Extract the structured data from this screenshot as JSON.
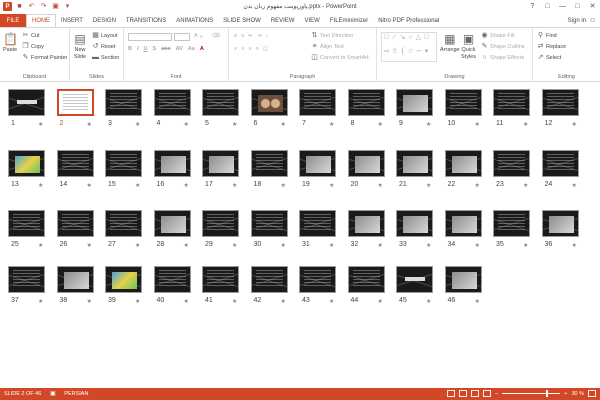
{
  "window": {
    "title": "پاورپوینت مفهوم زبان بدن.pptx - PowerPoint",
    "sign_in": "Sign in"
  },
  "tabs": [
    "FILE",
    "HOME",
    "INSERT",
    "DESIGN",
    "TRANSITIONS",
    "ANIMATIONS",
    "SLIDE SHOW",
    "REVIEW",
    "VIEW",
    "FILEminimizer",
    "Nitro PDF Professional"
  ],
  "ribbon": {
    "clipboard": {
      "label": "Clipboard",
      "paste": "Paste",
      "cut": "Cut",
      "copy": "Copy",
      "format_painter": "Format Painter"
    },
    "slides": {
      "label": "Slides",
      "new_slide": "New",
      "new_slide2": "Slide",
      "layout": "Layout",
      "reset": "Reset",
      "section": "Section"
    },
    "font": {
      "label": "Font"
    },
    "paragraph": {
      "label": "Paragraph",
      "text_direction": "Text Direction",
      "align_text": "Align Text",
      "convert": "Convert to SmartArt"
    },
    "drawing": {
      "label": "Drawing",
      "arrange": "Arrange",
      "quick_styles": "Quick",
      "quick_styles2": "Styles",
      "shape_fill": "Shape Fill",
      "shape_outline": "Shape Outline",
      "shape_effects": "Shape Effects"
    },
    "editing": {
      "label": "Editing",
      "find": "Find",
      "replace": "Replace",
      "select": "Select"
    }
  },
  "slides": [
    {
      "n": "1",
      "t": "logo"
    },
    {
      "n": "2",
      "t": "white"
    },
    {
      "n": "3",
      "t": "text"
    },
    {
      "n": "4",
      "t": "text"
    },
    {
      "n": "5",
      "t": "text"
    },
    {
      "n": "6",
      "t": "face"
    },
    {
      "n": "7",
      "t": "text"
    },
    {
      "n": "8",
      "t": "text"
    },
    {
      "n": "9",
      "t": "pic"
    },
    {
      "n": "10",
      "t": "text"
    },
    {
      "n": "11",
      "t": "text"
    },
    {
      "n": "12",
      "t": "text"
    },
    {
      "n": "13",
      "t": "color"
    },
    {
      "n": "14",
      "t": "text"
    },
    {
      "n": "15",
      "t": "text"
    },
    {
      "n": "16",
      "t": "pic"
    },
    {
      "n": "17",
      "t": "pic"
    },
    {
      "n": "18",
      "t": "text"
    },
    {
      "n": "19",
      "t": "pic"
    },
    {
      "n": "20",
      "t": "pic"
    },
    {
      "n": "21",
      "t": "pic"
    },
    {
      "n": "22",
      "t": "pic"
    },
    {
      "n": "23",
      "t": "text"
    },
    {
      "n": "24",
      "t": "text"
    },
    {
      "n": "25",
      "t": "text"
    },
    {
      "n": "26",
      "t": "text"
    },
    {
      "n": "27",
      "t": "text"
    },
    {
      "n": "28",
      "t": "pic"
    },
    {
      "n": "29",
      "t": "text"
    },
    {
      "n": "30",
      "t": "text"
    },
    {
      "n": "31",
      "t": "text"
    },
    {
      "n": "32",
      "t": "pic"
    },
    {
      "n": "33",
      "t": "pic"
    },
    {
      "n": "34",
      "t": "pic"
    },
    {
      "n": "35",
      "t": "text"
    },
    {
      "n": "36",
      "t": "pic"
    },
    {
      "n": "37",
      "t": "text"
    },
    {
      "n": "38",
      "t": "pic"
    },
    {
      "n": "39",
      "t": "color"
    },
    {
      "n": "40",
      "t": "text"
    },
    {
      "n": "41",
      "t": "text"
    },
    {
      "n": "42",
      "t": "text"
    },
    {
      "n": "43",
      "t": "text"
    },
    {
      "n": "44",
      "t": "text"
    },
    {
      "n": "45",
      "t": "logo"
    },
    {
      "n": "46",
      "t": "pic"
    }
  ],
  "status": {
    "slide_info": "SLIDE 2 OF 46",
    "language": "PERSIAN",
    "zoom": "30 %"
  },
  "colors": {
    "accent": "#d24726"
  }
}
